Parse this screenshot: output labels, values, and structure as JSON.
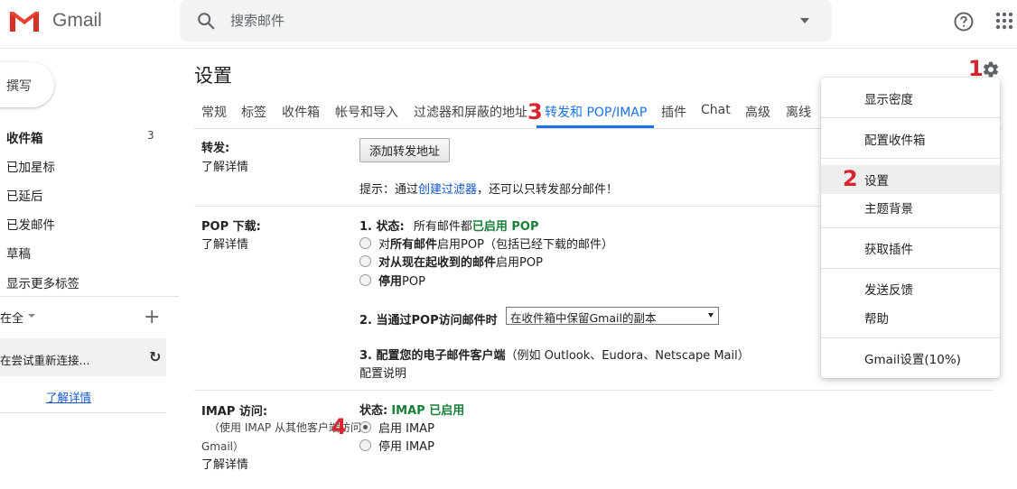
{
  "header": {
    "brand": "Gmail",
    "search_placeholder": "搜索邮件"
  },
  "sidebar": {
    "compose": "撰写",
    "items": [
      "收件箱",
      "已加星标",
      "已延后",
      "已发邮件",
      "草稿",
      "显示更多标签"
    ],
    "inbox_count": "3",
    "hangouts_user": "在全",
    "reconnect": "在尝试重新连接...",
    "learn_more": "了解详情"
  },
  "main": {
    "title": "设置",
    "tabs": [
      "常规",
      "标签",
      "收件箱",
      "帐号和导入",
      "过滤器和屏蔽的地址",
      "转发和 POP/IMAP",
      "插件",
      "Chat",
      "高级",
      "离线"
    ],
    "active_tab_index": 5,
    "forwarding": {
      "label": "转发:",
      "learn_more": "了解详情",
      "add_button": "添加转发地址",
      "tip_prefix": "提示：通过",
      "tip_link": "创建过滤器",
      "tip_suffix": "，还可以只转发部分邮件！"
    },
    "pop": {
      "label": "POP 下载:",
      "learn_more": "了解详情",
      "status_prefix": "1. 状态:",
      "status_mid": "所有邮件都",
      "status_value": "已启用 POP",
      "options": [
        {
          "bold": "",
          "pre": "对",
          "b": "所有邮件",
          "post": "启用POP（包括已经下载的邮件）"
        },
        {
          "pre": "",
          "b": "对从现在起收到的邮件",
          "post": "启用POP"
        },
        {
          "pre": "",
          "b": "停用",
          "post": "POP"
        }
      ],
      "when_accessed_label": "2. 当通过POP访问邮件时",
      "when_accessed_value": "在收件箱中保留Gmail的副本",
      "configure_label": "3. 配置您的电子邮件客户端",
      "configure_note": "（例如 Outlook、Eudora、Netscape Mail）",
      "configure_link": "配置说明"
    },
    "imap": {
      "label": "IMAP 访问:",
      "note_line1": "（使用 IMAP 从其他客户端访问",
      "note_line2": "Gmail）",
      "learn_more": "了解详情",
      "status_prefix": "状态:",
      "status_value": "IMAP 已启用",
      "enable": "启用 IMAP",
      "disable": "停用 IMAP",
      "selected": "enable"
    }
  },
  "menu": {
    "items": [
      "显示密度",
      "配置收件箱",
      "设置",
      "主题背景",
      "获取插件",
      "发送反馈",
      "帮助",
      "Gmail设置(10%)"
    ]
  },
  "annotations": [
    "1",
    "2",
    "3",
    "4"
  ],
  "colors": {
    "accent": "#1a73e8",
    "link": "#1155cc",
    "enabled_green": "#188038",
    "annotation_red": "#d6262f"
  }
}
